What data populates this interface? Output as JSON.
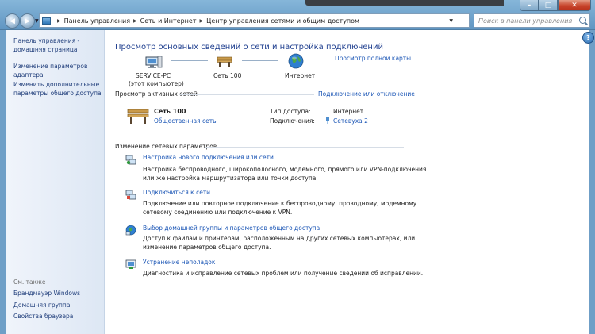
{
  "address": {
    "crumbs": [
      "Панель управления",
      "Сеть и Интернет",
      "Центр управления сетями и общим доступом"
    ],
    "search_placeholder": "Поиск в панели управления"
  },
  "window_buttons": {
    "minimize": "–",
    "maximize": "□",
    "close": "✕"
  },
  "help_label": "?",
  "sidebar": {
    "items": [
      {
        "label": "Панель управления - домашняя страница"
      },
      {
        "label": "Изменение параметров адаптера"
      },
      {
        "label": "Изменить дополнительные параметры общего доступа"
      }
    ],
    "see_also_title": "См. также",
    "see_also": [
      {
        "label": "Брандмауэр Windows"
      },
      {
        "label": "Домашняя группа"
      },
      {
        "label": "Свойства браузера"
      }
    ]
  },
  "main": {
    "title": "Просмотр основных сведений о сети и настройка подключений",
    "full_map_link": "Просмотр полной карты",
    "map": {
      "computer_name": "SERVICE-PC",
      "computer_sub": "(этот компьютер)",
      "network_name": "Сеть 100",
      "internet_label": "Интернет"
    },
    "active_networks": {
      "header": "Просмотр активных сетей",
      "connect_link": "Подключение или отключение",
      "network_name": "Сеть 100",
      "network_type": "Общественная сеть",
      "access_type_label": "Тип доступа:",
      "access_type_value": "Интернет",
      "connections_label": "Подключения:",
      "connections_value": "Сетевуха 2"
    },
    "change_settings": {
      "header": "Изменение сетевых параметров",
      "tasks": [
        {
          "title": "Настройка нового подключения или сети",
          "desc1": "Настройка беспроводного, широкополосного, модемного, прямого или VPN-подключения",
          "desc2": "или же настройка маршрутизатора или точки доступа."
        },
        {
          "title": "Подключиться к сети",
          "desc1": "Подключение или повторное подключение к беспроводному, проводному, модемному",
          "desc2": "сетевому соединению или подключение к VPN."
        },
        {
          "title": "Выбор домашней группы и параметров общего доступа",
          "desc1": "Доступ к файлам и принтерам, расположенным на других сетевых компьютерах, или",
          "desc2": "изменение параметров общего доступа."
        },
        {
          "title": "Устранение неполадок",
          "desc1": "Диагностика и исправление сетевых проблем или получение сведений об исправлении.",
          "desc2": ""
        }
      ]
    }
  },
  "colors": {
    "link": "#1a55b5",
    "title": "#1f3f8f",
    "frame": "#6f9fc7"
  }
}
